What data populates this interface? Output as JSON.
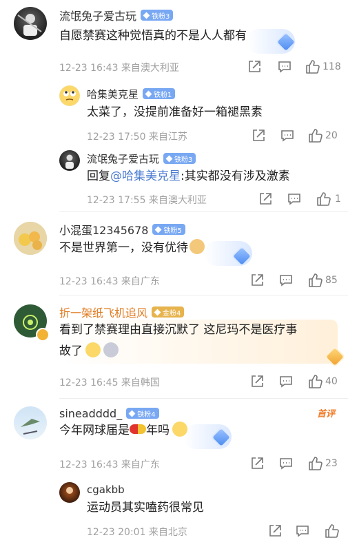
{
  "comments": [
    {
      "user": "流氓兔子爱古玩",
      "badge": "铁粉3",
      "text": "自愿禁赛这种觉悟真的不是人人都有",
      "meta": "12-23 16:43 来自澳大利亚",
      "likes": "118",
      "replies": [
        {
          "user": "哈集美克星",
          "badge": "铁粉1",
          "text": "太菜了，没提前准备好一箱褪黑素",
          "meta": "12-23 17:50 来自江苏",
          "likes": "20"
        },
        {
          "user": "流氓兔子爱古玩",
          "badge": "铁粉3",
          "text_prefix": "回复",
          "mention": "@哈集美克星",
          "text_suffix": ":其实都没有涉及激素",
          "meta": "12-23 17:55 来自澳大利亚",
          "likes": "1"
        }
      ]
    },
    {
      "user": "小混蛋12345678",
      "badge": "铁粉5",
      "text": "不是世界第一，没有优待",
      "meta": "12-23 16:43 来自广东",
      "likes": "85"
    },
    {
      "user": "折一架纸飞机追风",
      "badge": "金粉4",
      "text_line1": "看到了禁赛理由直接沉默了 这尼玛不是医疗事",
      "text_line2": "故了",
      "meta": "12-23 16:45 来自韩国",
      "likes": "40"
    },
    {
      "user": "sineadddd_",
      "badge": "铁粉4",
      "tag": "首评",
      "text_a": "今年网球届是",
      "text_b": "年吗",
      "meta": "12-23 16:43 来自广东",
      "likes": "23",
      "replies": [
        {
          "user": "cgakbb",
          "text": "运动员其实嗑药很常见",
          "meta": "12-23 20:01 来自北京",
          "likes": ""
        }
      ]
    }
  ],
  "colors": {
    "accent": "#4a7bd0",
    "gold": "#e07a1e",
    "badge_blue": "#79a8f3"
  }
}
